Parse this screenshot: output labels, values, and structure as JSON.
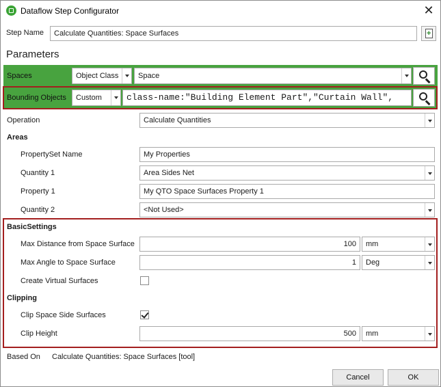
{
  "window": {
    "title": "Dataflow Step Configurator"
  },
  "step": {
    "label": "Step Name",
    "value": "Calculate Quantities: Space Surfaces"
  },
  "parameters_heading": "Parameters",
  "spaces": {
    "label": "Spaces",
    "mode": "Object Class",
    "value": "Space"
  },
  "bounding": {
    "label": "Bounding Objects",
    "mode": "Custom",
    "query": "class-name:\"Building Element Part\",\"Curtain Wall\","
  },
  "operation": {
    "label": "Operation",
    "value": "Calculate Quantities"
  },
  "areas": {
    "heading": "Areas",
    "propertyset_label": "PropertySet Name",
    "propertyset_value": "My Properties",
    "quantity1_label": "Quantity 1",
    "quantity1_value": "Area Sides Net",
    "property1_label": "Property 1",
    "property1_value": "My QTO Space Surfaces Property 1",
    "quantity2_label": "Quantity 2",
    "quantity2_value": "<Not Used>"
  },
  "basic": {
    "heading": "BasicSettings",
    "maxdist_label": "Max Distance from Space Surface",
    "maxdist_value": "100",
    "maxdist_unit": "mm",
    "maxangle_label": "Max Angle to Space Surface",
    "maxangle_value": "1",
    "maxangle_unit": "Deg",
    "virtual_label": "Create Virtual Surfaces",
    "virtual_checked": false
  },
  "clipping": {
    "heading": "Clipping",
    "clipside_label": "Clip Space Side Surfaces",
    "clipside_checked": true,
    "height_label": "Clip Height",
    "height_value": "500",
    "height_unit": "mm"
  },
  "based_on": {
    "label": "Based On",
    "value": "Calculate Quantities: Space Surfaces [tool]"
  },
  "buttons": {
    "cancel": "Cancel",
    "ok": "OK"
  },
  "colors": {
    "accent_green": "#48a33f",
    "highlight_red": "#a31e1e",
    "app_icon": "#3aa335"
  },
  "icons": {
    "app": "dataflow-app-icon",
    "close": "close-icon",
    "search": "search-icon",
    "new_step": "new-document-icon"
  }
}
